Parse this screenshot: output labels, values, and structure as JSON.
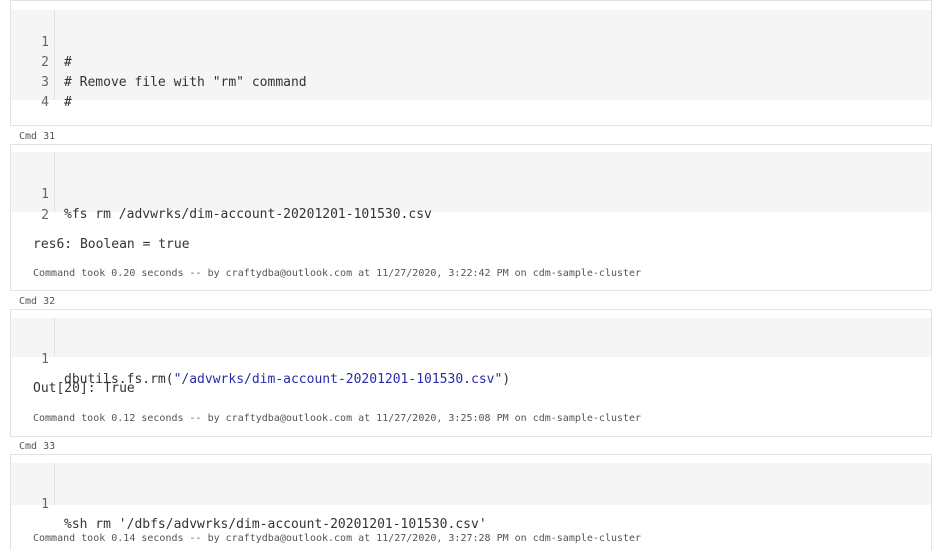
{
  "cells": [
    {
      "lines": [
        {
          "num": "1",
          "text": "#"
        },
        {
          "num": "2",
          "text": "# Remove file with \"rm\" command"
        },
        {
          "num": "3",
          "text": "#"
        },
        {
          "num": "4",
          "text": ""
        }
      ]
    },
    {
      "label": "Cmd 31",
      "lines": [
        {
          "num": "1",
          "text": "%fs rm /advwrks/dim-account-20201201-101530.csv"
        },
        {
          "num": "2",
          "text": ""
        }
      ],
      "output": "res6: Boolean = true",
      "footer": "Command took 0.20 seconds -- by craftydba@outlook.com at 11/27/2020, 3:22:42 PM on cdm-sample-cluster"
    },
    {
      "label": "Cmd 32",
      "lines": [
        {
          "num": "1",
          "prefix": "dbutils.fs.rm(",
          "string": "\"/advwrks/dim-account-20201201-101530.csv\"",
          "suffix": ")"
        }
      ],
      "output": "Out[20]: True",
      "footer": "Command took 0.12 seconds -- by craftydba@outlook.com at 11/27/2020, 3:25:08 PM on cdm-sample-cluster"
    },
    {
      "label": "Cmd 33",
      "lines": [
        {
          "num": "1",
          "text": "%sh rm '/dbfs/advwrks/dim-account-20201201-101530.csv'"
        }
      ],
      "footer": "Command took 0.14 seconds -- by craftydba@outlook.com at 11/27/2020, 3:27:28 PM on cdm-sample-cluster"
    }
  ]
}
